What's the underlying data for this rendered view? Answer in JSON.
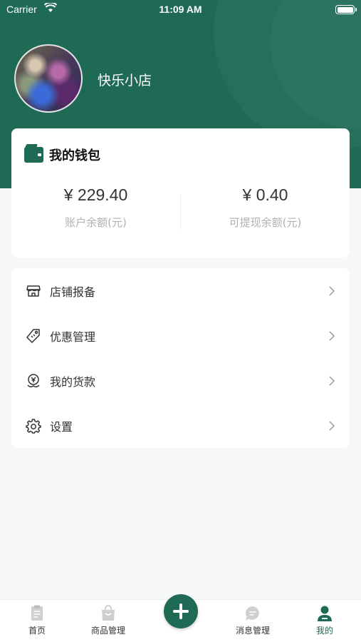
{
  "status_bar": {
    "carrier": "Carrier",
    "time": "11:09 AM"
  },
  "profile": {
    "shop_name": "快乐小店"
  },
  "wallet": {
    "title": "我的钱包",
    "balance_amount": "¥ 229.40",
    "balance_label": "账户余额(元)",
    "withdrawable_amount": "¥ 0.40",
    "withdrawable_label": "可提现余额(元)"
  },
  "menu": {
    "items": [
      {
        "label": "店铺报备",
        "icon": "store-icon"
      },
      {
        "label": "优惠管理",
        "icon": "tag-icon"
      },
      {
        "label": "我的货款",
        "icon": "money-icon"
      },
      {
        "label": "设置",
        "icon": "gear-icon"
      }
    ]
  },
  "tabbar": {
    "items": [
      {
        "label": "首页",
        "icon": "document-icon"
      },
      {
        "label": "商品管理",
        "icon": "bag-icon"
      },
      {
        "label": "消息管理",
        "icon": "message-icon"
      },
      {
        "label": "我的",
        "icon": "user-icon",
        "active": true
      }
    ],
    "fab_icon": "plus-icon"
  },
  "colors": {
    "brand": "#1e6a55",
    "background": "#f6f7f9",
    "muted_text": "#b0b0b0"
  }
}
